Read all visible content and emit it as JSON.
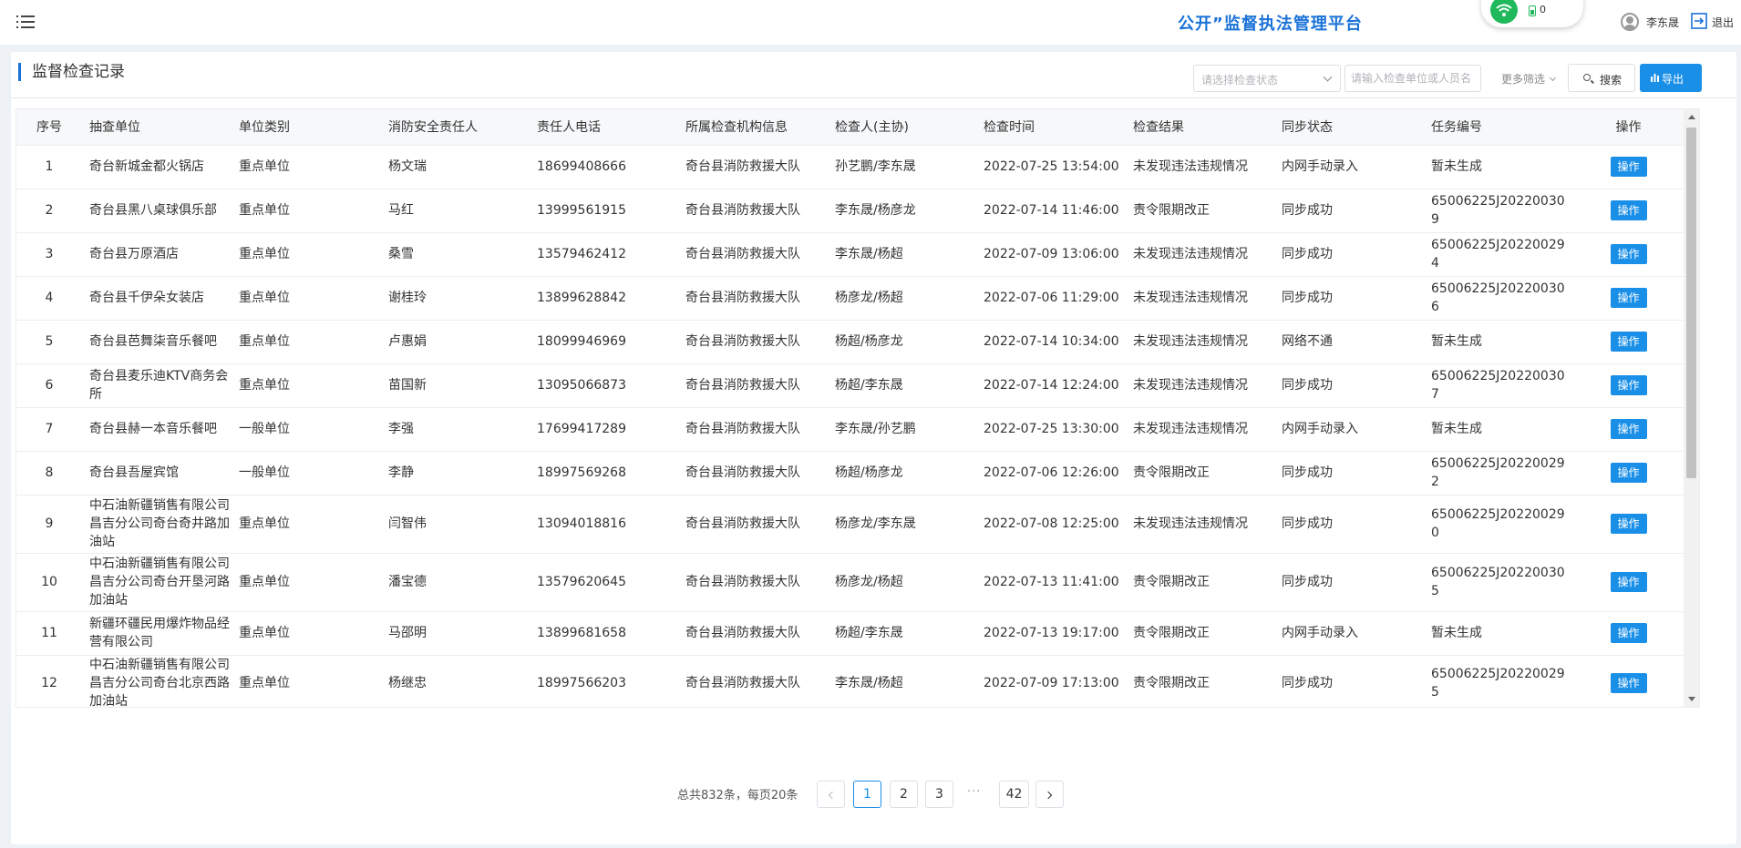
{
  "header": {
    "platform_title": "公开”监督执法管理平台",
    "wifi_count": "0",
    "user_name": "李东晟",
    "logout_label": "退出"
  },
  "page": {
    "title": "监督检查记录"
  },
  "filters": {
    "status_placeholder": "请选择检查状态",
    "keyword_placeholder": "请输入检查单位或人员名",
    "more_label": "更多筛选",
    "search_label": "搜索",
    "export_label": "导出"
  },
  "table": {
    "columns": [
      "序号",
      "抽查单位",
      "单位类别",
      "消防安全责任人",
      "责任人电话",
      "所属检查机构信息",
      "检查人(主协)",
      "检查时间",
      "检查结果",
      "同步状态",
      "任务编号",
      "操作"
    ],
    "action_label": "操作",
    "rows": [
      {
        "no": "1",
        "unit": "奇台新城金都火锅店",
        "category": "重点单位",
        "person": "杨文瑞",
        "phone": "18699408666",
        "org": "奇台县消防救援大队",
        "inspectors": "孙艺鹏/李东晟",
        "time": "2022-07-25 13:54:00",
        "result": "未发现违法违规情况",
        "sync": "内网手动录入",
        "task": "暂未生成"
      },
      {
        "no": "2",
        "unit": "奇台县黑八桌球俱乐部",
        "category": "重点单位",
        "person": "马红",
        "phone": "13999561915",
        "org": "奇台县消防救援大队",
        "inspectors": "李东晟/杨彦龙",
        "time": "2022-07-14 11:46:00",
        "result": "责令限期改正",
        "sync": "同步成功",
        "task": "65006225J202200309"
      },
      {
        "no": "3",
        "unit": "奇台县万原酒店",
        "category": "重点单位",
        "person": "桑雪",
        "phone": "13579462412",
        "org": "奇台县消防救援大队",
        "inspectors": "李东晟/杨超",
        "time": "2022-07-09 13:06:00",
        "result": "未发现违法违规情况",
        "sync": "同步成功",
        "task": "65006225J202200294"
      },
      {
        "no": "4",
        "unit": "奇台县千伊朵女装店",
        "category": "重点单位",
        "person": "谢桂玲",
        "phone": "13899628842",
        "org": "奇台县消防救援大队",
        "inspectors": "杨彦龙/杨超",
        "time": "2022-07-06 11:29:00",
        "result": "未发现违法违规情况",
        "sync": "同步成功",
        "task": "65006225J202200306"
      },
      {
        "no": "5",
        "unit": "奇台县芭舞柒音乐餐吧",
        "category": "重点单位",
        "person": "卢惠娟",
        "phone": "18099946969",
        "org": "奇台县消防救援大队",
        "inspectors": "杨超/杨彦龙",
        "time": "2022-07-14 10:34:00",
        "result": "未发现违法违规情况",
        "sync": "网络不通",
        "task": "暂未生成"
      },
      {
        "no": "6",
        "unit": "奇台县麦乐迪KTV商务会所",
        "category": "重点单位",
        "person": "苗国新",
        "phone": "13095066873",
        "org": "奇台县消防救援大队",
        "inspectors": "杨超/李东晟",
        "time": "2022-07-14 12:24:00",
        "result": "未发现违法违规情况",
        "sync": "同步成功",
        "task": "65006225J202200307"
      },
      {
        "no": "7",
        "unit": "奇台县赫一本音乐餐吧",
        "category": "一般单位",
        "person": "李强",
        "phone": "17699417289",
        "org": "奇台县消防救援大队",
        "inspectors": "李东晟/孙艺鹏",
        "time": "2022-07-25 13:30:00",
        "result": "未发现违法违规情况",
        "sync": "内网手动录入",
        "task": "暂未生成"
      },
      {
        "no": "8",
        "unit": "奇台县吾屋宾馆",
        "category": "一般单位",
        "person": "李静",
        "phone": "18997569268",
        "org": "奇台县消防救援大队",
        "inspectors": "杨超/杨彦龙",
        "time": "2022-07-06 12:26:00",
        "result": "责令限期改正",
        "sync": "同步成功",
        "task": "65006225J202200292"
      },
      {
        "no": "9",
        "unit": "中石油新疆销售有限公司昌吉分公司奇台奇井路加油站",
        "category": "重点单位",
        "person": "闫智伟",
        "phone": "13094018816",
        "org": "奇台县消防救援大队",
        "inspectors": "杨彦龙/李东晟",
        "time": "2022-07-08 12:25:00",
        "result": "未发现违法违规情况",
        "sync": "同步成功",
        "task": "65006225J202200290"
      },
      {
        "no": "10",
        "unit": "中石油新疆销售有限公司昌吉分公司奇台开垦河路加油站",
        "category": "重点单位",
        "person": "潘宝德",
        "phone": "13579620645",
        "org": "奇台县消防救援大队",
        "inspectors": "杨彦龙/杨超",
        "time": "2022-07-13 11:41:00",
        "result": "责令限期改正",
        "sync": "同步成功",
        "task": "65006225J202200305"
      },
      {
        "no": "11",
        "unit": "新疆环疆民用爆炸物品经营有限公司",
        "category": "重点单位",
        "person": "马邵明",
        "phone": "13899681658",
        "org": "奇台县消防救援大队",
        "inspectors": "杨超/李东晟",
        "time": "2022-07-13 19:17:00",
        "result": "责令限期改正",
        "sync": "内网手动录入",
        "task": "暂未生成"
      },
      {
        "no": "12",
        "unit": "中石油新疆销售有限公司昌吉分公司奇台北京西路加油站",
        "category": "重点单位",
        "person": "杨继忠",
        "phone": "18997566203",
        "org": "奇台县消防救援大队",
        "inspectors": "李东晟/杨超",
        "time": "2022-07-09 17:13:00",
        "result": "责令限期改正",
        "sync": "同步成功",
        "task": "65006225J202200295"
      }
    ]
  },
  "pagination": {
    "total_text": "总共832条，每页20条",
    "pages": [
      "1",
      "2",
      "3"
    ],
    "ellipsis": "···",
    "last_page": "42",
    "current": "1"
  },
  "colors": {
    "primary": "#1a8fe8",
    "brand_title": "#1a72d8",
    "wifi_green": "#1fb95c"
  }
}
